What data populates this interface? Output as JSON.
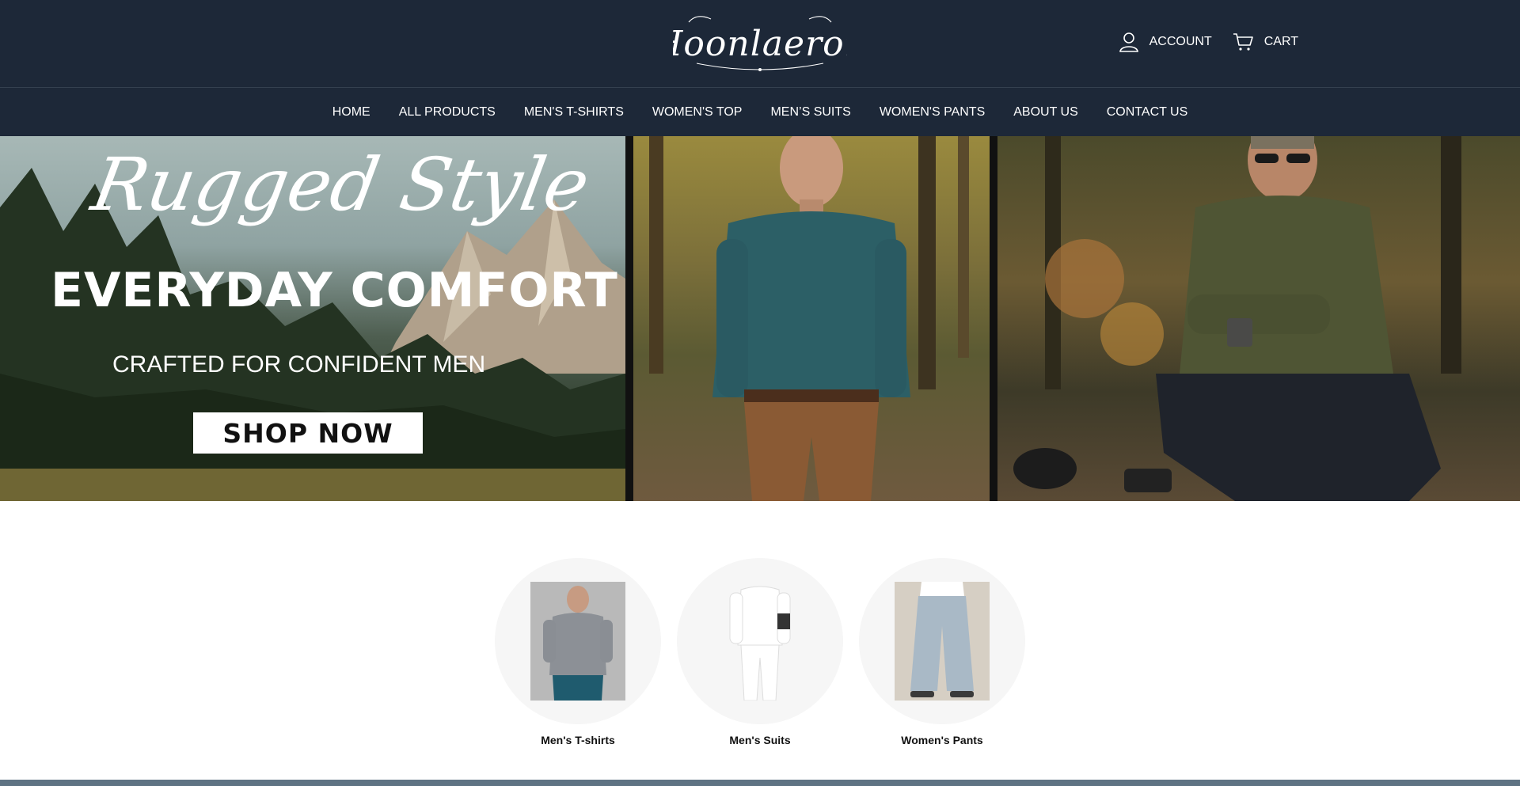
{
  "brand": {
    "name": "Hoonlaeron"
  },
  "header": {
    "account_label": "ACCOUNT",
    "cart_label": "CART"
  },
  "nav": {
    "items": [
      {
        "label": "HOME"
      },
      {
        "label": "ALL PRODUCTS"
      },
      {
        "label": "MEN'S T-SHIRTS"
      },
      {
        "label": "WOMEN'S TOP"
      },
      {
        "label": "MEN’S SUITS"
      },
      {
        "label": "WOMEN'S PANTS"
      },
      {
        "label": "ABOUT US"
      },
      {
        "label": "CONTACT US"
      }
    ]
  },
  "hero": {
    "script_text": "Rugged Style",
    "title": "EVERYDAY COMFORT",
    "subtitle": "CRAFTED FOR CONFIDENT MEN",
    "cta_label": "SHOP NOW"
  },
  "categories": [
    {
      "label": "Men's T-shirts"
    },
    {
      "label": "Men's Suits"
    },
    {
      "label": "Women's Pants"
    }
  ],
  "colors": {
    "header_bg": "#1d2838",
    "text_light": "#ffffff",
    "category_bg": "#f6f6f6",
    "bottom_strip": "#5f7383"
  },
  "icons": {
    "account": "user-icon",
    "cart": "cart-icon"
  }
}
